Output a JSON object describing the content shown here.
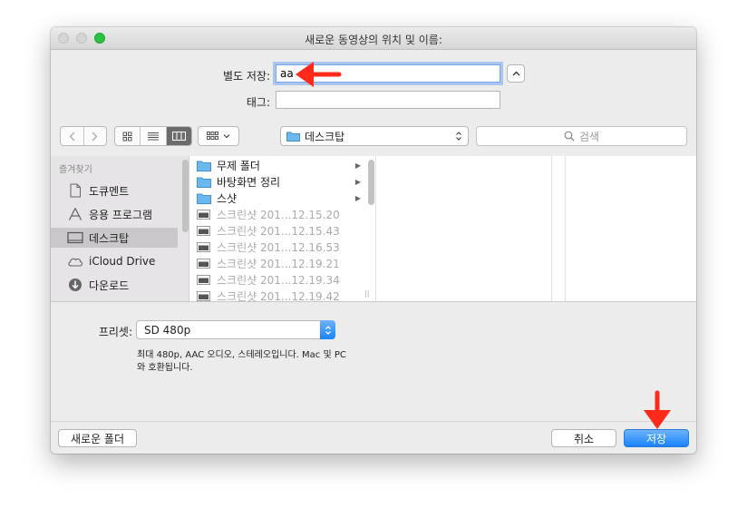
{
  "window": {
    "title": "새로운 동영상의 위치 및 이름:"
  },
  "form": {
    "save_as_label": "별도 저장:",
    "save_as_value": "aa",
    "tags_label": "태그:",
    "tags_value": "",
    "expand_icon": "chevron-up-icon"
  },
  "toolbar": {
    "back_icon": "chevron-left-icon",
    "forward_icon": "chevron-right-icon",
    "view_modes": [
      "icon-view",
      "list-view",
      "column-view"
    ],
    "selected_view": "column-view",
    "group_icon": "grid-dropdown-icon",
    "location": "데스크탑",
    "search_placeholder": "검색"
  },
  "sidebar": {
    "heading": "즐겨찾기",
    "items": [
      {
        "label": "도큐멘트",
        "icon": "document-icon"
      },
      {
        "label": "응용 프로그램",
        "icon": "applications-icon"
      },
      {
        "label": "데스크탑",
        "icon": "desktop-icon",
        "selected": true
      },
      {
        "label": "iCloud Drive",
        "icon": "cloud-icon"
      },
      {
        "label": "다운로드",
        "icon": "download-icon"
      }
    ]
  },
  "files": [
    {
      "name": "무제 폴더",
      "kind": "folder"
    },
    {
      "name": "바탕화면 정리",
      "kind": "folder"
    },
    {
      "name": "스샷",
      "kind": "folder"
    },
    {
      "name": "스크린샷 201...12.15.20",
      "kind": "image"
    },
    {
      "name": "스크린샷 201...12.15.43",
      "kind": "image"
    },
    {
      "name": "스크린샷 201...12.16.53",
      "kind": "image"
    },
    {
      "name": "스크린샷 201...12.19.21",
      "kind": "image"
    },
    {
      "name": "스크린샷 201...12.19.34",
      "kind": "image"
    },
    {
      "name": "스크린샷 201...12.19.42",
      "kind": "image"
    }
  ],
  "preset": {
    "label": "프리셋:",
    "value": "SD 480p",
    "description": "최대 480p, AAC 오디오, 스테레오입니다. Mac 및 PC와 호환됩니다."
  },
  "footer": {
    "new_folder": "새로운 폴더",
    "cancel": "취소",
    "save": "저장"
  },
  "colors": {
    "accent": "#1a82fb",
    "annotation_arrow": "#ff2a1a",
    "selection": "#c9c7c9"
  }
}
